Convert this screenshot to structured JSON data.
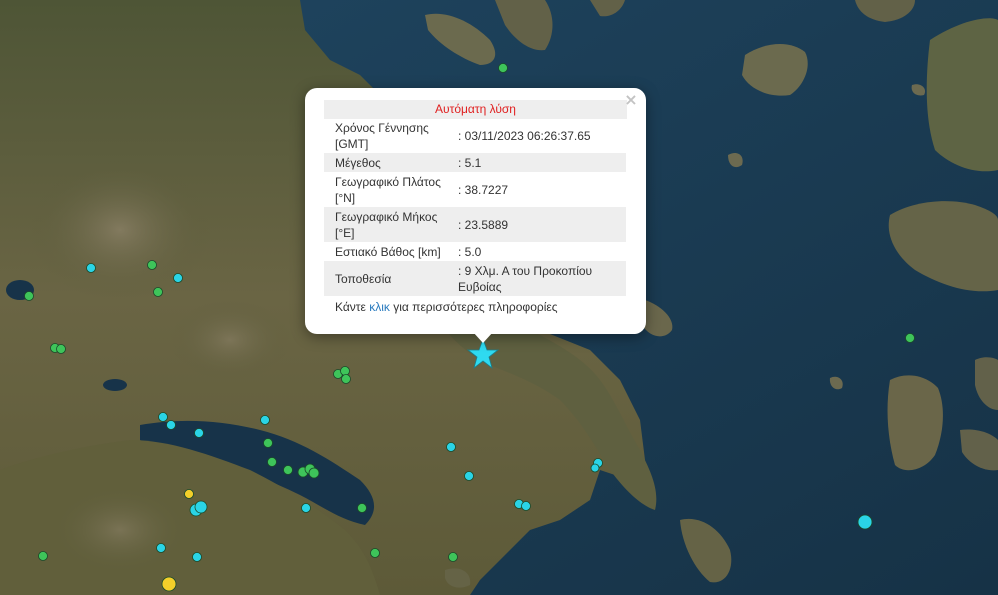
{
  "popup": {
    "title": "Αυτόματη λύση",
    "close_symbol": "×",
    "rows": [
      {
        "label": "Χρόνος Γέννησης [GMT]",
        "value": ": 03/11/2023 06:26:37.65"
      },
      {
        "label": "Μέγεθος",
        "value": ": 5.1"
      },
      {
        "label": "Γεωγραφικό Πλάτος [°N]",
        "value": ": 38.7227"
      },
      {
        "label": "Γεωγραφικό Μήκος [°E]",
        "value": ": 23.5889"
      },
      {
        "label": "Εστιακό Βάθος [km]",
        "value": ": 5.0"
      },
      {
        "label": "Τοποθεσία",
        "value": ": 9 Χλμ. Α του Προκοπίου Ευβοίας"
      }
    ],
    "more_prefix": "Κάντε ",
    "more_link": "κλικ",
    "more_suffix": " για περισσότερες πληροφορίες"
  },
  "colors": {
    "sea": "#1d3a52",
    "land": "#5b5a3a",
    "marker_cyan": "#2ad4e6",
    "marker_green": "#3ec45a",
    "marker_yellow": "#f3cf2a",
    "star": "#2fdaf0",
    "title_red": "#e02020",
    "link_blue": "#2a7bbf"
  },
  "map": {
    "icons": [
      "epicenter-star-icon",
      "earthquake-marker-icon"
    ],
    "epicenter": {
      "lat": 38.7227,
      "lon": 23.5889
    }
  }
}
